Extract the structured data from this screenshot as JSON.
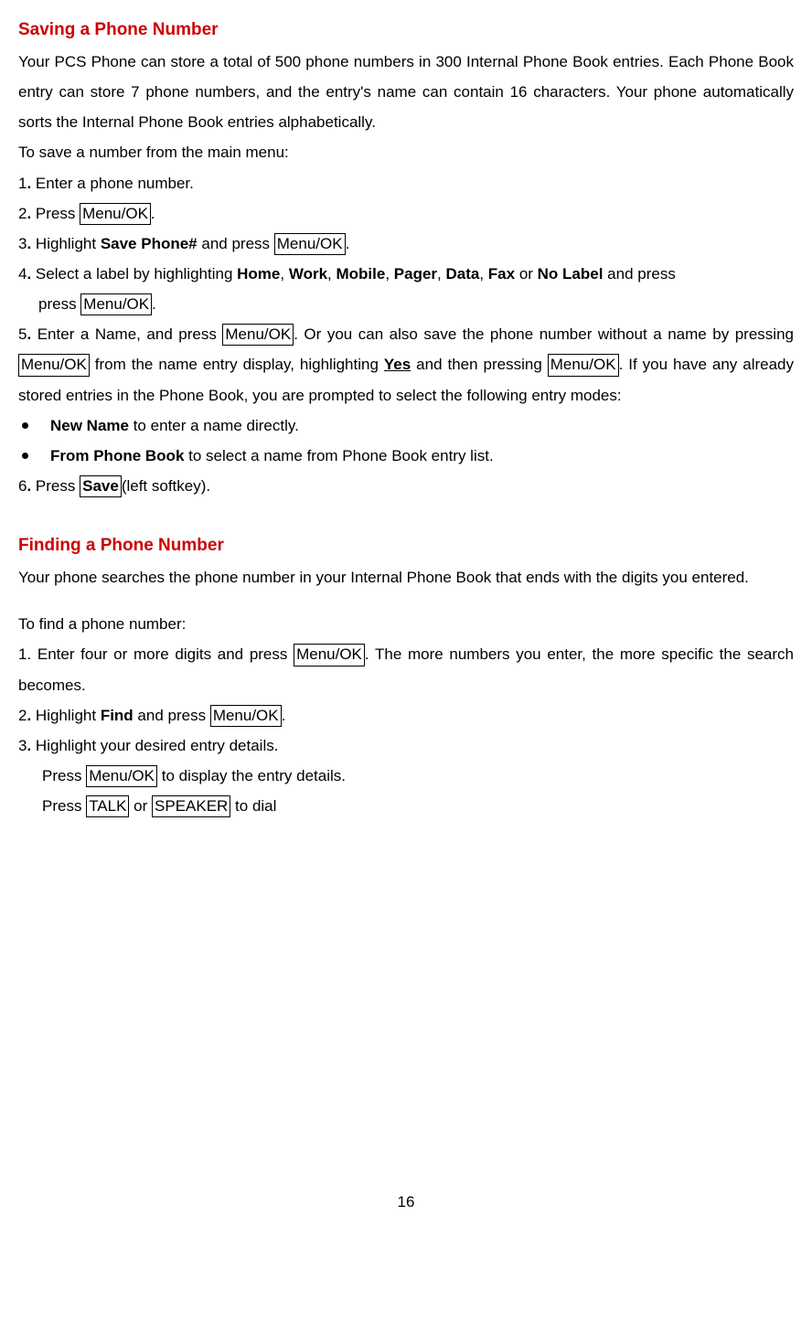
{
  "section1": {
    "title": "Saving a Phone Number",
    "intro": "Your PCS Phone can store a total of 500 phone numbers in 300 Internal Phone Book entries. Each Phone Book entry can store 7 phone numbers, and the entry's name can contain 16 characters. Your phone automatically sorts the Internal Phone Book entries alphabetically.",
    "lead": "To save a number from the main menu:",
    "s1_num": "1",
    "s1_dot": ".",
    "s1_text": " Enter a phone number.",
    "s2_num": "2",
    "s2_dot": ".",
    "s2_text1": " Press ",
    "s2_btn": "Menu/OK",
    "s2_text2": ".",
    "s3_num": "3",
    "s3_dot": ".",
    "s3_text1": " Highlight ",
    "s3_bold": "Save Phone#",
    "s3_text2": " and press ",
    "s3_btn": "Menu/OK",
    "s3_text3": ".",
    "s4_num": "4",
    "s4_dot": ".",
    "s4_text1": " Select a label by highlighting ",
    "s4_b1": "Home",
    "s4_c1": ", ",
    "s4_b2": "Work",
    "s4_c2": ", ",
    "s4_b3": "Mobile",
    "s4_c3": ", ",
    "s4_b4": "Pager",
    "s4_c4": ", ",
    "s4_b5": "Data",
    "s4_c5": ", ",
    "s4_b6": "Fax",
    "s4_or": " or ",
    "s4_b7": "No Label",
    "s4_text2": " and press ",
    "s4_btn": "Menu/OK",
    "s4_text3": ".",
    "s5_num": "5",
    "s5_dot": ".",
    "s5_text1": " Enter a Name, and press ",
    "s5_btn1": "Menu/OK",
    "s5_text2": ". Or you can also save the phone number without a name by pressing ",
    "s5_btn2": "Menu/OK",
    "s5_text3": " from the name entry display, highlighting ",
    "s5_yes": "Yes",
    "s5_text4": " and then pressing ",
    "s5_btn3": "Menu/OK",
    "s5_text5": ". If you have any already stored entries in the Phone Book, you are prompted to select the following entry modes:",
    "bullet1_bold": "New Name",
    "bullet1_rest": " to enter a name directly.",
    "bullet2_bold": "From Phone Book",
    "bullet2_rest": " to select a name from Phone Book entry list.",
    "s6_num": "6",
    "s6_dot": ".",
    "s6_text1": " Press ",
    "s6_bold": "Save",
    "s6_text2": "(left softkey)."
  },
  "section2": {
    "title": "Finding a Phone Number",
    "intro": "Your phone searches the phone number in your Internal Phone Book that ends with the digits you entered.",
    "lead": "To find a phone number:",
    "s1_text1": "1. Enter four or more digits and press ",
    "s1_btn": "Menu/OK",
    "s1_text2": ". The more numbers you enter, the more specific the search becomes.",
    "s2_num": "2",
    "s2_dot": ".",
    "s2_text1": " Highlight ",
    "s2_bold": "Find",
    "s2_text2": " and press ",
    "s2_btn": "Menu/OK",
    "s2_text3": ".",
    "s3_num": "3",
    "s3_dot": ".",
    "s3_text": " Highlight your desired entry details.",
    "sub1_text1": "Press ",
    "sub1_btn": "Menu/OK",
    "sub1_text2": " to display the entry details.",
    "sub2_text1": "Press ",
    "sub2_btn1": "TALK",
    "sub2_or": " or ",
    "sub2_btn2": "SPEAKER",
    "sub2_text2": " to dial"
  },
  "page": "16"
}
